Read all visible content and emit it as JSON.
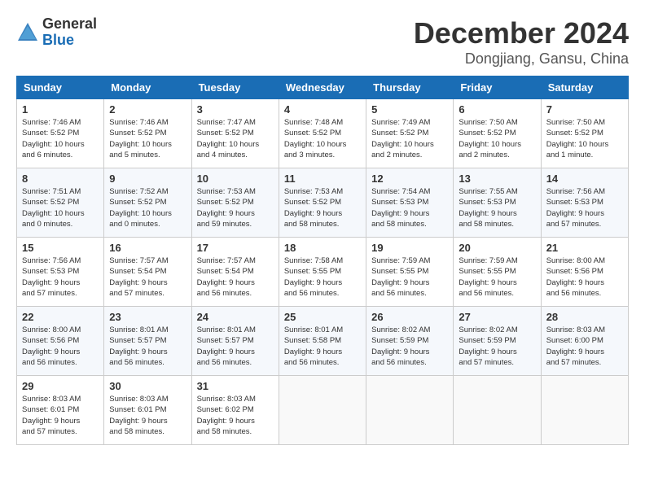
{
  "logo": {
    "general": "General",
    "blue": "Blue"
  },
  "title": {
    "month": "December 2024",
    "location": "Dongjiang, Gansu, China"
  },
  "weekdays": [
    "Sunday",
    "Monday",
    "Tuesday",
    "Wednesday",
    "Thursday",
    "Friday",
    "Saturday"
  ],
  "weeks": [
    [
      {
        "day": "1",
        "info": "Sunrise: 7:46 AM\nSunset: 5:52 PM\nDaylight: 10 hours\nand 6 minutes."
      },
      {
        "day": "2",
        "info": "Sunrise: 7:46 AM\nSunset: 5:52 PM\nDaylight: 10 hours\nand 5 minutes."
      },
      {
        "day": "3",
        "info": "Sunrise: 7:47 AM\nSunset: 5:52 PM\nDaylight: 10 hours\nand 4 minutes."
      },
      {
        "day": "4",
        "info": "Sunrise: 7:48 AM\nSunset: 5:52 PM\nDaylight: 10 hours\nand 3 minutes."
      },
      {
        "day": "5",
        "info": "Sunrise: 7:49 AM\nSunset: 5:52 PM\nDaylight: 10 hours\nand 2 minutes."
      },
      {
        "day": "6",
        "info": "Sunrise: 7:50 AM\nSunset: 5:52 PM\nDaylight: 10 hours\nand 2 minutes."
      },
      {
        "day": "7",
        "info": "Sunrise: 7:50 AM\nSunset: 5:52 PM\nDaylight: 10 hours\nand 1 minute."
      }
    ],
    [
      {
        "day": "8",
        "info": "Sunrise: 7:51 AM\nSunset: 5:52 PM\nDaylight: 10 hours\nand 0 minutes."
      },
      {
        "day": "9",
        "info": "Sunrise: 7:52 AM\nSunset: 5:52 PM\nDaylight: 10 hours\nand 0 minutes."
      },
      {
        "day": "10",
        "info": "Sunrise: 7:53 AM\nSunset: 5:52 PM\nDaylight: 9 hours\nand 59 minutes."
      },
      {
        "day": "11",
        "info": "Sunrise: 7:53 AM\nSunset: 5:52 PM\nDaylight: 9 hours\nand 58 minutes."
      },
      {
        "day": "12",
        "info": "Sunrise: 7:54 AM\nSunset: 5:53 PM\nDaylight: 9 hours\nand 58 minutes."
      },
      {
        "day": "13",
        "info": "Sunrise: 7:55 AM\nSunset: 5:53 PM\nDaylight: 9 hours\nand 58 minutes."
      },
      {
        "day": "14",
        "info": "Sunrise: 7:56 AM\nSunset: 5:53 PM\nDaylight: 9 hours\nand 57 minutes."
      }
    ],
    [
      {
        "day": "15",
        "info": "Sunrise: 7:56 AM\nSunset: 5:53 PM\nDaylight: 9 hours\nand 57 minutes."
      },
      {
        "day": "16",
        "info": "Sunrise: 7:57 AM\nSunset: 5:54 PM\nDaylight: 9 hours\nand 57 minutes."
      },
      {
        "day": "17",
        "info": "Sunrise: 7:57 AM\nSunset: 5:54 PM\nDaylight: 9 hours\nand 56 minutes."
      },
      {
        "day": "18",
        "info": "Sunrise: 7:58 AM\nSunset: 5:55 PM\nDaylight: 9 hours\nand 56 minutes."
      },
      {
        "day": "19",
        "info": "Sunrise: 7:59 AM\nSunset: 5:55 PM\nDaylight: 9 hours\nand 56 minutes."
      },
      {
        "day": "20",
        "info": "Sunrise: 7:59 AM\nSunset: 5:55 PM\nDaylight: 9 hours\nand 56 minutes."
      },
      {
        "day": "21",
        "info": "Sunrise: 8:00 AM\nSunset: 5:56 PM\nDaylight: 9 hours\nand 56 minutes."
      }
    ],
    [
      {
        "day": "22",
        "info": "Sunrise: 8:00 AM\nSunset: 5:56 PM\nDaylight: 9 hours\nand 56 minutes."
      },
      {
        "day": "23",
        "info": "Sunrise: 8:01 AM\nSunset: 5:57 PM\nDaylight: 9 hours\nand 56 minutes."
      },
      {
        "day": "24",
        "info": "Sunrise: 8:01 AM\nSunset: 5:57 PM\nDaylight: 9 hours\nand 56 minutes."
      },
      {
        "day": "25",
        "info": "Sunrise: 8:01 AM\nSunset: 5:58 PM\nDaylight: 9 hours\nand 56 minutes."
      },
      {
        "day": "26",
        "info": "Sunrise: 8:02 AM\nSunset: 5:59 PM\nDaylight: 9 hours\nand 56 minutes."
      },
      {
        "day": "27",
        "info": "Sunrise: 8:02 AM\nSunset: 5:59 PM\nDaylight: 9 hours\nand 57 minutes."
      },
      {
        "day": "28",
        "info": "Sunrise: 8:03 AM\nSunset: 6:00 PM\nDaylight: 9 hours\nand 57 minutes."
      }
    ],
    [
      {
        "day": "29",
        "info": "Sunrise: 8:03 AM\nSunset: 6:01 PM\nDaylight: 9 hours\nand 57 minutes."
      },
      {
        "day": "30",
        "info": "Sunrise: 8:03 AM\nSunset: 6:01 PM\nDaylight: 9 hours\nand 58 minutes."
      },
      {
        "day": "31",
        "info": "Sunrise: 8:03 AM\nSunset: 6:02 PM\nDaylight: 9 hours\nand 58 minutes."
      },
      null,
      null,
      null,
      null
    ]
  ]
}
